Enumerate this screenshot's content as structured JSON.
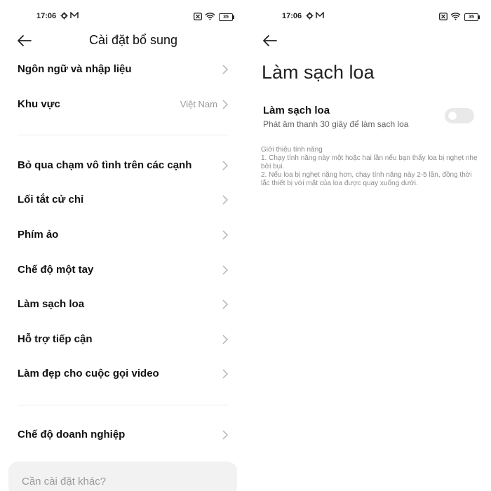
{
  "status_bar": {
    "time": "17:06",
    "battery": "35"
  },
  "left": {
    "title": "Cài đặt bổ sung",
    "items_top": [
      {
        "label": "Ngôn ngữ và nhập liệu",
        "value": ""
      },
      {
        "label": "Khu vực",
        "value": "Việt Nam"
      }
    ],
    "items_mid": [
      {
        "label": "Bỏ qua chạm vô tình trên các cạnh"
      },
      {
        "label": "Lối tắt cử chỉ"
      },
      {
        "label": "Phím ảo"
      },
      {
        "label": "Chế độ một tay"
      },
      {
        "label": "Làm sạch loa"
      },
      {
        "label": "Hỗ trợ tiếp cận"
      },
      {
        "label": "Làm đẹp cho cuộc gọi video"
      }
    ],
    "items_bottom": [
      {
        "label": "Chế độ doanh nghiệp"
      }
    ],
    "search_placeholder": "Cần cài đặt khác?"
  },
  "right": {
    "title": "Làm sạch loa",
    "toggle": {
      "label": "Làm sạch loa",
      "description": "Phát âm thanh 30 giây để làm sạch loa",
      "state": "off"
    },
    "intro": {
      "heading": "Giới thiệu tính năng",
      "line1": "1. Chạy tính năng này một hoặc hai lần nếu bạn thấy loa bị nghẹt nhẹ bởi bụi.",
      "line2": "2. Nếu loa bị nghẹt nặng hơn, chạy tính năng này 2-5 lần, đồng thời lắc thiết bị với mặt của loa được quay xuống dưới."
    }
  },
  "colors": {
    "divider": "#ececec",
    "secondary_text": "#9a9a9a",
    "toggle_off": "#e9e9e9",
    "search_bg": "#f2f2f2"
  }
}
